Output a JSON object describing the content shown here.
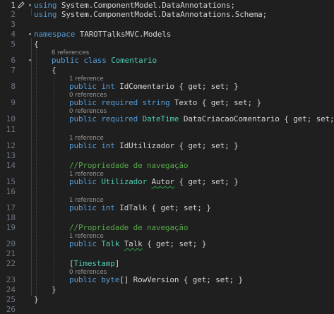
{
  "line_numbers": [
    "1",
    "2",
    "3",
    "4",
    "5",
    "6",
    "7",
    "8",
    "9",
    "10",
    "11",
    "12",
    "13",
    "14",
    "15",
    "16",
    "17",
    "18",
    "19",
    "20",
    "21",
    "22",
    "23",
    "24",
    "25",
    "26"
  ],
  "code": {
    "l1": {
      "kw": "using",
      "rest": " System.ComponentModel.DataAnnotations;"
    },
    "l2": {
      "kw": "using",
      "rest": " System.ComponentModel.DataAnnotations.Schema;"
    },
    "l4": {
      "kw": "namespace",
      "rest": " TAROTTalksMVC.Models"
    },
    "l5": "{",
    "l6_ref": "6 references",
    "l6": {
      "kw1": "public",
      "kw2": "class",
      "type": "Comentario"
    },
    "l7": "{",
    "l8_ref": "1 reference",
    "l8": {
      "kw1": "public",
      "kw2": "int",
      "name": "IdComentario",
      "rest": " { get; set; }"
    },
    "l9_ref": "0 references",
    "l9": {
      "kw1": "public",
      "kw2": "required",
      "kw3": "string",
      "name": "Texto",
      "rest": " { get; set; }"
    },
    "l10_ref": "0 references",
    "l10": {
      "kw1": "public",
      "kw2": "required",
      "type": "DateTime",
      "name": "DataCriacaoComentario",
      "rest": " { get; set; }"
    },
    "l12_ref": "1 reference",
    "l12": {
      "kw1": "public",
      "kw2": "int",
      "name": "IdUtilizador",
      "rest": " { get; set; }"
    },
    "l14": "//Propriedade de navegação",
    "l15_ref": "1 reference",
    "l15": {
      "kw1": "public",
      "type": "Utilizador",
      "name": "Autor",
      "rest": " { get; set; }"
    },
    "l17_ref": "1 reference",
    "l17": {
      "kw1": "public",
      "kw2": "int",
      "name": "IdTalk",
      "rest": " { get; set; }"
    },
    "l19": "//Propriedade de navegação",
    "l20_ref": "1 reference",
    "l20": {
      "kw1": "public",
      "type": "Talk",
      "name": "Talk",
      "rest": " { get; set; }"
    },
    "l22": {
      "open": "[",
      "type": "Timestamp",
      "close": "]"
    },
    "l23_ref": "0 references",
    "l23": {
      "kw1": "public",
      "kw2": "byte",
      "brackets": "[]",
      "name": "RowVersion",
      "rest": " { get; set; }"
    },
    "l24": "}",
    "l25": "}"
  },
  "fold_icon": "chevron-down-icon",
  "colors": {
    "background": "#1f1f1f",
    "keyword": "#569cd6",
    "type": "#4ec9b0",
    "comment": "#57a64a",
    "text": "#d4d4d4",
    "line_number": "#6e7681"
  }
}
